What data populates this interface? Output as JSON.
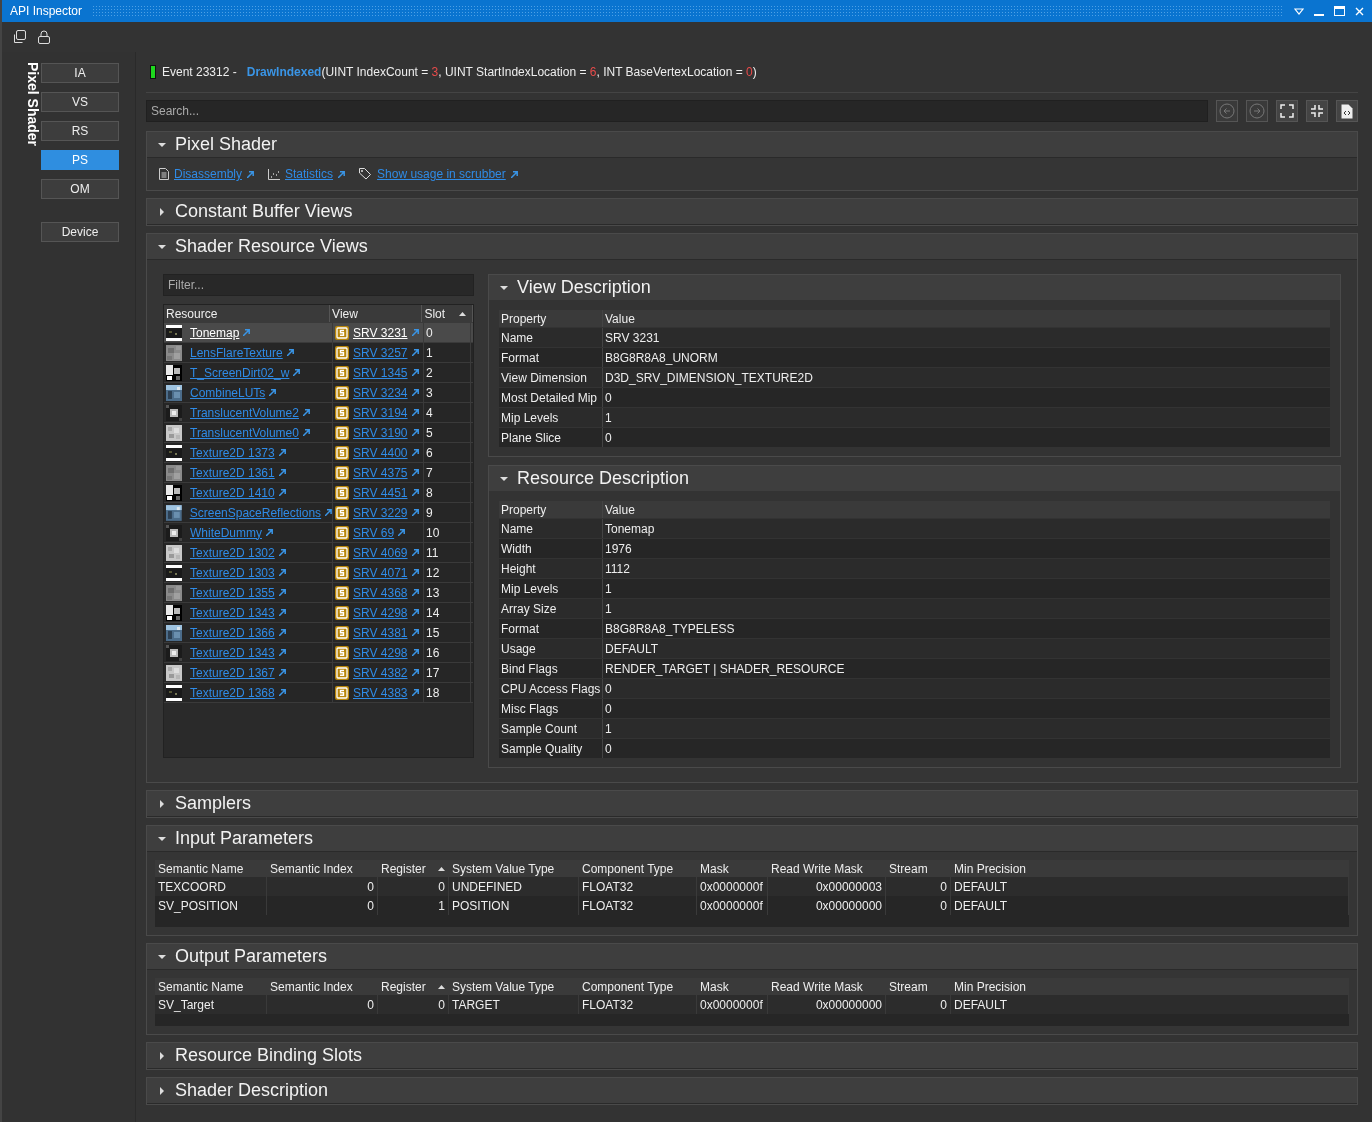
{
  "window": {
    "title": "API Inspector"
  },
  "stage_label": "Pixel Shader",
  "stages": [
    {
      "label": "IA",
      "selected": false
    },
    {
      "label": "VS",
      "selected": false
    },
    {
      "label": "RS",
      "selected": false
    },
    {
      "label": "PS",
      "selected": true
    },
    {
      "label": "OM",
      "selected": false
    }
  ],
  "device_button": {
    "label": "Device",
    "selected": false
  },
  "event": {
    "label": "Event 23312 -",
    "function": "DrawIndexed",
    "signature": [
      {
        "kind": "plain",
        "text": "(UINT IndexCount = "
      },
      {
        "kind": "value",
        "text": "3"
      },
      {
        "kind": "plain",
        "text": ", UINT StartIndexLocation = "
      },
      {
        "kind": "value",
        "text": "6"
      },
      {
        "kind": "plain",
        "text": ", INT BaseVertexLocation = "
      },
      {
        "kind": "value",
        "text": "0"
      },
      {
        "kind": "plain",
        "text": ")"
      }
    ]
  },
  "search": {
    "placeholder": "Search..."
  },
  "sections": [
    {
      "kind": "links",
      "title": "Pixel Shader",
      "expanded": true,
      "links": [
        {
          "kind": "document",
          "label": "Disassembly"
        },
        {
          "kind": "chart",
          "label": "Statistics"
        },
        {
          "kind": "tag",
          "label": "Show usage in scrubber"
        }
      ]
    },
    {
      "title": "Constant Buffer Views",
      "expanded": false
    },
    {
      "kind": "srv",
      "title": "Shader Resource Views",
      "expanded": true,
      "filter": {
        "placeholder": "Filter..."
      },
      "columns": [
        "Resource",
        "View",
        "Slot"
      ],
      "rows": [
        {
          "resource": "Tonemap",
          "view": "SRV 3231",
          "slot": "0",
          "selected": true
        },
        {
          "resource": "LensFlareTexture",
          "view": "SRV 3257",
          "slot": "1",
          "selected": false
        },
        {
          "resource": "T_ScreenDirt02_w",
          "view": "SRV 1345",
          "slot": "2",
          "selected": false
        },
        {
          "resource": "CombineLUTs",
          "view": "SRV 3234",
          "slot": "3",
          "selected": false
        },
        {
          "resource": "TranslucentVolume2",
          "view": "SRV 3194",
          "slot": "4",
          "selected": false
        },
        {
          "resource": "TranslucentVolume0",
          "view": "SRV 3190",
          "slot": "5",
          "selected": false
        },
        {
          "resource": "Texture2D 1373",
          "view": "SRV 4400",
          "slot": "6",
          "selected": false
        },
        {
          "resource": "Texture2D 1361",
          "view": "SRV 4375",
          "slot": "7",
          "selected": false
        },
        {
          "resource": "Texture2D 1410",
          "view": "SRV 4451",
          "slot": "8",
          "selected": false
        },
        {
          "resource": "ScreenSpaceReflections",
          "view": "SRV 3229",
          "slot": "9",
          "selected": false
        },
        {
          "resource": "WhiteDummy",
          "view": "SRV 69",
          "slot": "10",
          "selected": false
        },
        {
          "resource": "Texture2D 1302",
          "view": "SRV 4069",
          "slot": "11",
          "selected": false
        },
        {
          "resource": "Texture2D 1303",
          "view": "SRV 4071",
          "slot": "12",
          "selected": false
        },
        {
          "resource": "Texture2D 1355",
          "view": "SRV 4368",
          "slot": "13",
          "selected": false
        },
        {
          "resource": "Texture2D 1343",
          "view": "SRV 4298",
          "slot": "14",
          "selected": false
        },
        {
          "resource": "Texture2D 1366",
          "view": "SRV 4381",
          "slot": "15",
          "selected": false
        },
        {
          "resource": "Texture2D 1343",
          "view": "SRV 4298",
          "slot": "16",
          "selected": false
        },
        {
          "resource": "Texture2D 1367",
          "view": "SRV 4382",
          "slot": "17",
          "selected": false
        },
        {
          "resource": "Texture2D 1368",
          "view": "SRV 4383",
          "slot": "18",
          "selected": false
        }
      ],
      "panels": [
        {
          "title": "View Description",
          "expanded": true,
          "columns": [
            "Property",
            "Value"
          ],
          "rows": [
            [
              "Name",
              "SRV 3231"
            ],
            [
              "Format",
              "B8G8R8A8_UNORM"
            ],
            [
              "View Dimension",
              "D3D_SRV_DIMENSION_TEXTURE2D"
            ],
            [
              "Most Detailed Mip",
              "0"
            ],
            [
              "Mip Levels",
              "1"
            ],
            [
              "Plane Slice",
              "0"
            ]
          ]
        },
        {
          "title": "Resource Description",
          "expanded": true,
          "columns": [
            "Property",
            "Value"
          ],
          "rows": [
            [
              "Name",
              "Tonemap"
            ],
            [
              "Width",
              "1976"
            ],
            [
              "Height",
              "1112"
            ],
            [
              "Mip Levels",
              "1"
            ],
            [
              "Array Size",
              "1"
            ],
            [
              "Format",
              "B8G8R8A8_TYPELESS"
            ],
            [
              "Usage",
              "DEFAULT"
            ],
            [
              "Bind Flags",
              "RENDER_TARGET | SHADER_RESOURCE"
            ],
            [
              "CPU Access Flags",
              "0"
            ],
            [
              "Misc Flags",
              "0"
            ],
            [
              "Sample Count",
              "1"
            ],
            [
              "Sample Quality",
              "0"
            ]
          ]
        }
      ]
    },
    {
      "title": "Samplers",
      "expanded": false
    },
    {
      "kind": "params",
      "title": "Input Parameters",
      "expanded": true,
      "columns": [
        "Semantic Name",
        "Semantic Index",
        "Register",
        "System Value Type",
        "Component Type",
        "Mask",
        "Read Write Mask",
        "Stream",
        "Min Precision"
      ],
      "rows": [
        [
          "TEXCOORD",
          "0",
          "0",
          "UNDEFINED",
          "FLOAT32",
          "0x0000000f",
          "0x00000003",
          "0",
          "DEFAULT"
        ],
        [
          "SV_POSITION",
          "0",
          "1",
          "POSITION",
          "FLOAT32",
          "0x0000000f",
          "0x00000000",
          "0",
          "DEFAULT"
        ]
      ]
    },
    {
      "kind": "params",
      "title": "Output Parameters",
      "expanded": true,
      "columns": [
        "Semantic Name",
        "Semantic Index",
        "Register",
        "System Value Type",
        "Component Type",
        "Mask",
        "Read Write Mask",
        "Stream",
        "Min Precision"
      ],
      "rows": [
        [
          "SV_Target",
          "0",
          "0",
          "TARGET",
          "FLOAT32",
          "0x0000000f",
          "0x00000000",
          "0",
          "DEFAULT"
        ]
      ]
    },
    {
      "title": "Resource Binding Slots",
      "expanded": false
    },
    {
      "title": "Shader Description",
      "expanded": false
    }
  ]
}
